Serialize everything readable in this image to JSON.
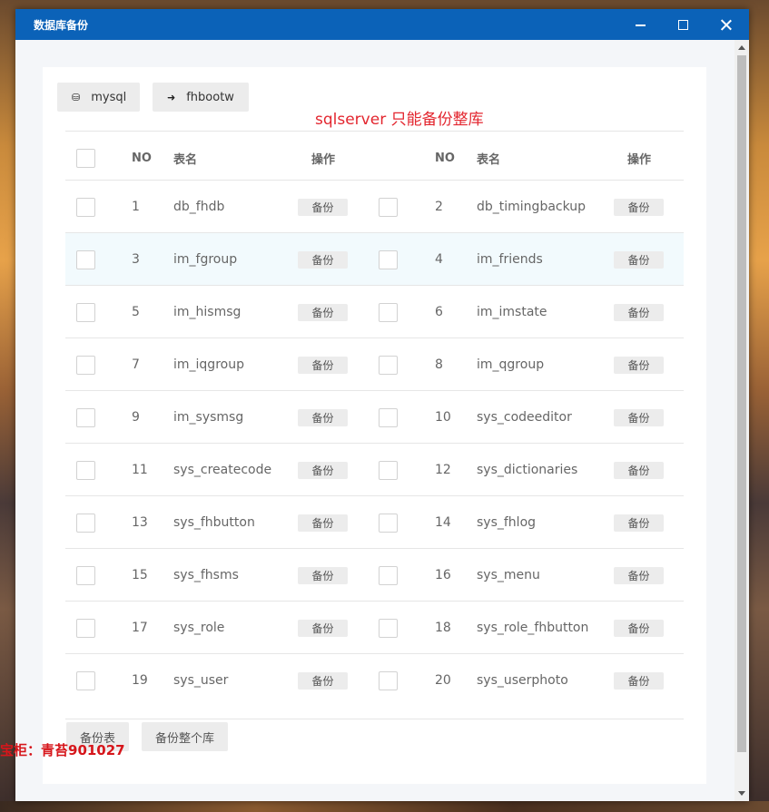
{
  "window": {
    "title": "数据库备份"
  },
  "databases": [
    {
      "label": "mysql",
      "icon": "database-icon"
    },
    {
      "label": "fhbootw",
      "icon": "arrow-right-icon"
    }
  ],
  "notice": "sqlserver 只能备份整库",
  "table": {
    "headers": {
      "no": "NO",
      "name": "表名",
      "op": "操作"
    },
    "op_label": "备份",
    "rows": [
      [
        {
          "no": "1",
          "name": "db_fhdb"
        },
        {
          "no": "2",
          "name": "db_timingbackup"
        }
      ],
      [
        {
          "no": "3",
          "name": "im_fgroup"
        },
        {
          "no": "4",
          "name": "im_friends"
        }
      ],
      [
        {
          "no": "5",
          "name": "im_hismsg"
        },
        {
          "no": "6",
          "name": "im_imstate"
        }
      ],
      [
        {
          "no": "7",
          "name": "im_iqgroup"
        },
        {
          "no": "8",
          "name": "im_qgroup"
        }
      ],
      [
        {
          "no": "9",
          "name": "im_sysmsg"
        },
        {
          "no": "10",
          "name": "sys_codeeditor"
        }
      ],
      [
        {
          "no": "11",
          "name": "sys_createcode"
        },
        {
          "no": "12",
          "name": "sys_dictionaries"
        }
      ],
      [
        {
          "no": "13",
          "name": "sys_fhbutton"
        },
        {
          "no": "14",
          "name": "sys_fhlog"
        }
      ],
      [
        {
          "no": "15",
          "name": "sys_fhsms"
        },
        {
          "no": "16",
          "name": "sys_menu"
        }
      ],
      [
        {
          "no": "17",
          "name": "sys_role"
        },
        {
          "no": "18",
          "name": "sys_role_fhbutton"
        }
      ],
      [
        {
          "no": "19",
          "name": "sys_user"
        },
        {
          "no": "20",
          "name": "sys_userphoto"
        }
      ]
    ]
  },
  "footer": {
    "backup_table_label": "备份表",
    "backup_all_label": "备份整个库"
  },
  "watermark": "宝柜：青苔901027",
  "colors": {
    "titlebar": "#0b62b8",
    "notice": "#e3262f",
    "row_hover": "#f2fafd"
  }
}
